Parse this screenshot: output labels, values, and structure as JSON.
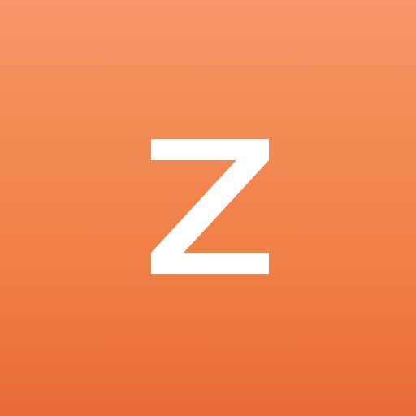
{
  "app_icon": {
    "letter": "Z",
    "background_top": "#f9966a",
    "background_bottom": "#e86a38",
    "glyph_color": "#ffffff"
  }
}
